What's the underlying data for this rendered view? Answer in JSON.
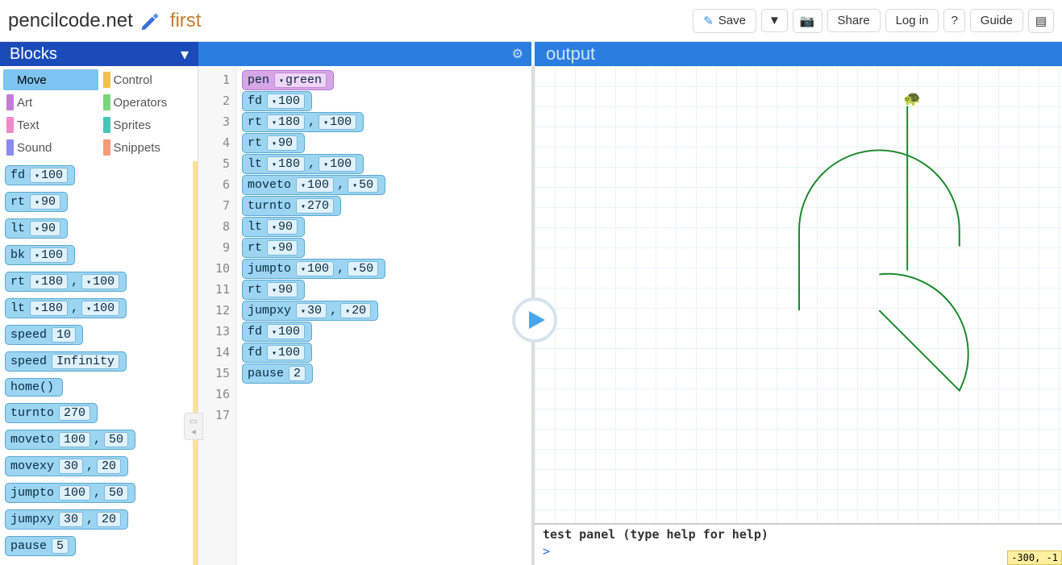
{
  "header": {
    "site": "pencilcode.net",
    "docname": "first",
    "save": "Save",
    "share": "Share",
    "login": "Log in",
    "help": "?",
    "guide": "Guide"
  },
  "panels": {
    "blocks": "Blocks",
    "output": "output"
  },
  "categories": [
    {
      "label": "Move",
      "color": "#7ec4f0",
      "selected": true
    },
    {
      "label": "Control",
      "color": "#f3c04e"
    },
    {
      "label": "Art",
      "color": "#c77bd9"
    },
    {
      "label": "Operators",
      "color": "#7bd67b"
    },
    {
      "label": "Text",
      "color": "#f08acb"
    },
    {
      "label": "Sprites",
      "color": "#46c5b7"
    },
    {
      "label": "Sound",
      "color": "#8a8af0"
    },
    {
      "label": "Snippets",
      "color": "#f59a7b"
    }
  ],
  "palette_blocks": [
    {
      "cmd": "fd",
      "args": [
        "100"
      ]
    },
    {
      "cmd": "rt",
      "args": [
        "90"
      ]
    },
    {
      "cmd": "lt",
      "args": [
        "90"
      ]
    },
    {
      "cmd": "bk",
      "args": [
        "100"
      ]
    },
    {
      "cmd": "rt",
      "args": [
        "180",
        "100"
      ]
    },
    {
      "cmd": "lt",
      "args": [
        "180",
        "100"
      ]
    },
    {
      "cmd": "speed",
      "args": [
        "10"
      ],
      "plain": true
    },
    {
      "cmd": "speed",
      "args": [
        "Infinity"
      ],
      "plain": true
    },
    {
      "cmd": "home()",
      "args": []
    },
    {
      "cmd": "turnto",
      "args": [
        "270"
      ],
      "plain": true
    },
    {
      "cmd": "moveto",
      "args": [
        "100",
        "50"
      ],
      "plain": true
    },
    {
      "cmd": "movexy",
      "args": [
        "30",
        "20"
      ],
      "plain": true
    },
    {
      "cmd": "jumpto",
      "args": [
        "100",
        "50"
      ],
      "plain": true
    },
    {
      "cmd": "jumpxy",
      "args": [
        "30",
        "20"
      ],
      "plain": true
    },
    {
      "cmd": "pause",
      "args": [
        "5"
      ],
      "plain": true
    }
  ],
  "code_lines": [
    {
      "n": 1,
      "cmd": "pen",
      "args": [
        "green"
      ],
      "purple": true
    },
    {
      "n": 2,
      "cmd": "fd",
      "args": [
        "100"
      ]
    },
    {
      "n": 3,
      "cmd": "rt",
      "args": [
        "180",
        "100"
      ]
    },
    {
      "n": 4,
      "cmd": "rt",
      "args": [
        "90"
      ]
    },
    {
      "n": 5,
      "cmd": "lt",
      "args": [
        "180",
        "100"
      ]
    },
    {
      "n": 6,
      "cmd": "moveto",
      "args": [
        "100",
        "50"
      ]
    },
    {
      "n": 7,
      "cmd": "turnto",
      "args": [
        "270"
      ]
    },
    {
      "n": 8,
      "cmd": "lt",
      "args": [
        "90"
      ]
    },
    {
      "n": 9,
      "cmd": "rt",
      "args": [
        "90"
      ]
    },
    {
      "n": 10,
      "cmd": "jumpto",
      "args": [
        "100",
        "50"
      ]
    },
    {
      "n": 11,
      "cmd": "rt",
      "args": [
        "90"
      ]
    },
    {
      "n": 12,
      "cmd": "jumpxy",
      "args": [
        "30",
        "20"
      ]
    },
    {
      "n": 13,
      "cmd": "fd",
      "args": [
        "100"
      ]
    },
    {
      "n": 14,
      "cmd": "fd",
      "args": [
        "100"
      ]
    },
    {
      "n": 15,
      "cmd": "pause",
      "args": [
        "2"
      ],
      "plain": true
    },
    {
      "n": 16,
      "cmd": "",
      "args": []
    },
    {
      "n": 17,
      "cmd": "",
      "args": []
    }
  ],
  "testpanel": {
    "label": "test panel (type help for help)",
    "prompt": ">"
  },
  "coords": "-300, -1"
}
